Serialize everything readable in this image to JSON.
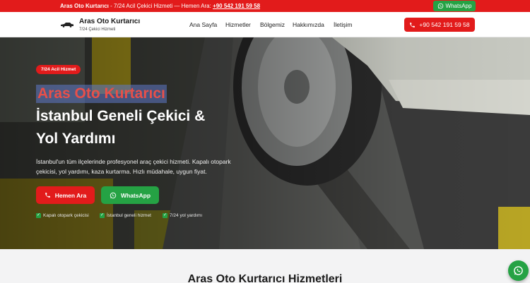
{
  "topbar": {
    "brand": "Aras Oto Kurtarıcı",
    "message": " - 7/24 Acil Çekici Hizmeti — Hemen Ara: ",
    "phone": "+90 542 191 59 58",
    "whatsapp_label": "WhatsApp",
    "whatsapp_icon": "whatsapp-icon"
  },
  "header": {
    "brand_title": "Aras Oto Kurtarıcı",
    "brand_subtitle": "7/24 Çekici Hizmeti",
    "nav": [
      "Ana Sayfa",
      "Hizmetler",
      "Bölgemiz",
      "Hakkımızda",
      "İletişim"
    ],
    "call_label": "+90 542 191 59 58",
    "call_icon": "phone-icon"
  },
  "hero": {
    "badge": "7/24 Acil Hizmet",
    "title_highlight": "Aras Oto Kurtarıcı",
    "title_line2": "İstanbul Geneli Çekici &",
    "title_line3": "Yol Yardımı",
    "lead_line1": "İstanbul'un tüm ilçelerinde profesyonel araç çekici hizmeti. Kapalı otopark",
    "lead_line2": "çekicisi, yol yardımı, kaza kurtarma. Hızlı müdahale, uygun fiyat.",
    "call_button": "Hemen Ara",
    "whatsapp_button": "WhatsApp",
    "features": [
      "Kapalı otopark çekicisi",
      "İstanbul geneli hizmet",
      "7/24 yol yardımı"
    ]
  },
  "services": {
    "title": "Aras Oto Kurtarıcı Hizmetleri"
  },
  "colors": {
    "brand_red": "#e21b1b",
    "whatsapp_green": "#25a244"
  }
}
